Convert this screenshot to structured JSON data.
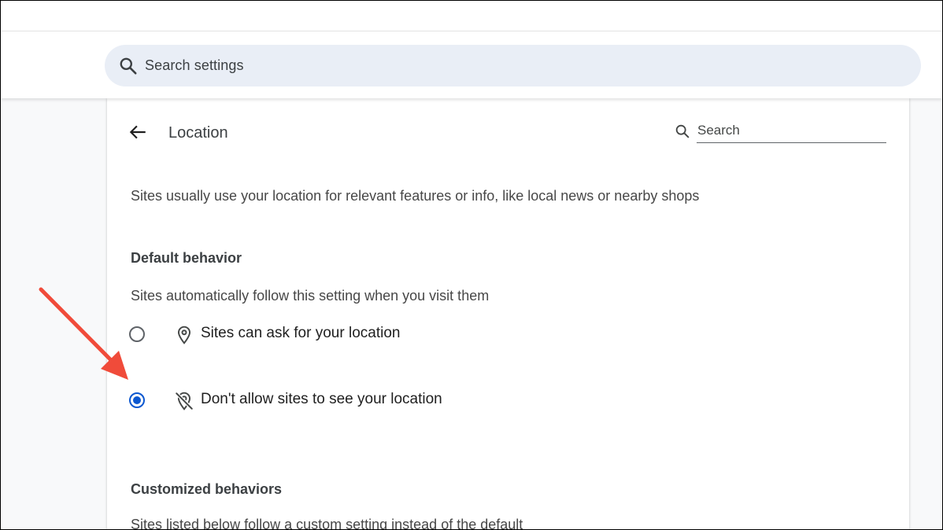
{
  "search_bar": {
    "placeholder": "Search settings",
    "icon": "search-icon"
  },
  "page": {
    "title": "Location",
    "back_icon": "arrow-back-icon",
    "search_placeholder": "Search",
    "description": "Sites usually use your location for relevant features or info, like local news or nearby shops"
  },
  "default_behavior": {
    "heading": "Default behavior",
    "subtext": "Sites automatically follow this setting when you visit them",
    "options": [
      {
        "label": "Sites can ask for your location",
        "icon": "location-pin-icon",
        "selected": false
      },
      {
        "label": "Don't allow sites to see your location",
        "icon": "location-off-icon",
        "selected": true
      }
    ]
  },
  "customized_behaviors": {
    "heading": "Customized behaviors",
    "subtext": "Sites listed below follow a custom setting instead of the default"
  },
  "colors": {
    "accent": "#0b57d0",
    "annotation_arrow": "#f04b3a",
    "search_bg": "#e9eef6"
  }
}
